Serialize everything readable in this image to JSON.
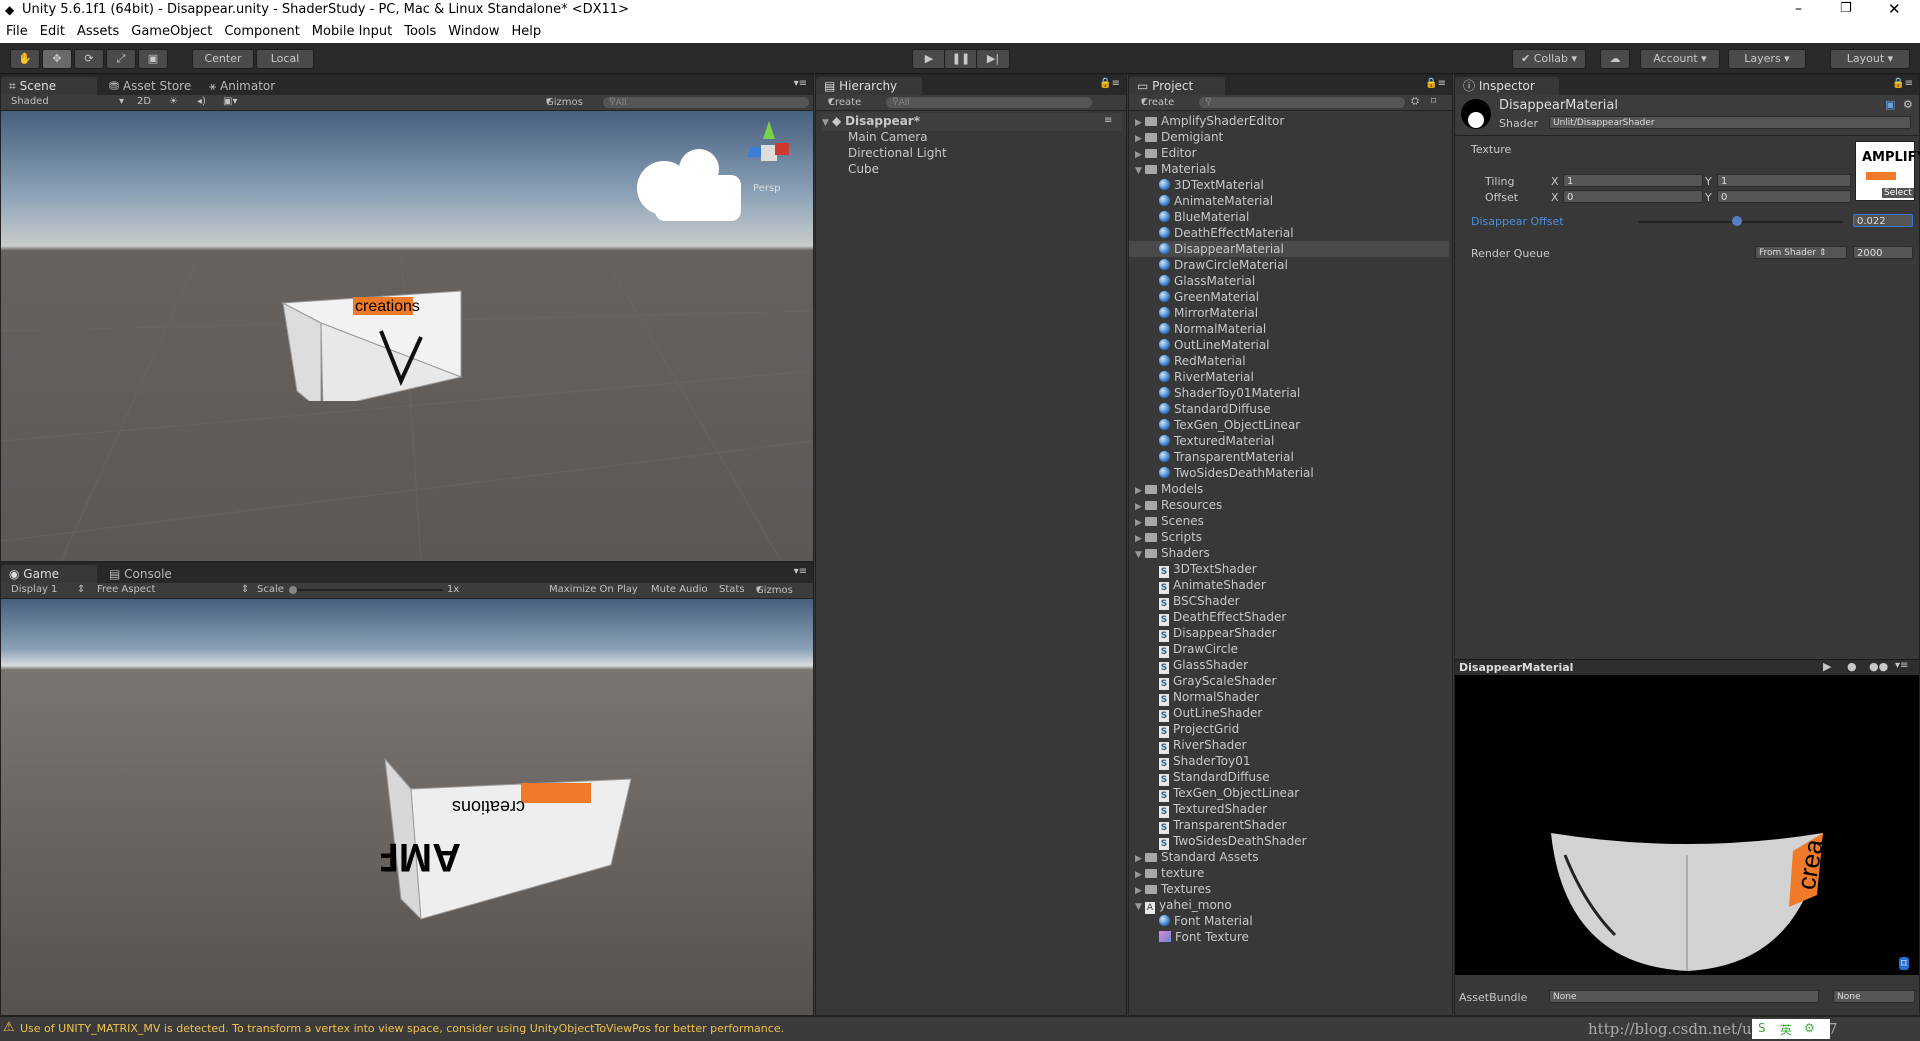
{
  "window": {
    "title": "Unity 5.6.1f1 (64bit) - Disappear.unity - ShaderStudy - PC, Mac & Linux Standalone* <DX11>"
  },
  "menu": [
    "File",
    "Edit",
    "Assets",
    "GameObject",
    "Component",
    "Mobile Input",
    "Tools",
    "Window",
    "Help"
  ],
  "toolbar": {
    "center": "Center",
    "local": "Local",
    "collab": "Collab",
    "account": "Account",
    "layers": "Layers",
    "layout": "Layout"
  },
  "scene_panel": {
    "tabs": [
      "Scene",
      "Asset Store",
      "Animator"
    ],
    "shaded": "Shaded",
    "mode_2d": "2D",
    "gizmos": "Gizmos",
    "search": "All",
    "persp": "Persp",
    "cube_text": "creations"
  },
  "game_panel": {
    "tabs": [
      "Game",
      "Console"
    ],
    "display": "Display 1",
    "aspect": "Free Aspect",
    "scale_label": "Scale",
    "scale_value": "1x",
    "maximize": "Maximize On Play",
    "mute": "Mute Audio",
    "stats": "Stats",
    "gizmos": "Gizmos",
    "cube_text_top": "creations",
    "cube_text_main": "AMPLIFY"
  },
  "hierarchy": {
    "tab": "Hierarchy",
    "create": "Create",
    "search": "All",
    "scene": "Disappear*",
    "items": [
      "Main Camera",
      "Directional Light",
      "Cube"
    ]
  },
  "project": {
    "tab": "Project",
    "create": "Create",
    "top_folders": [
      "AmplifyShaderEditor",
      "Demigiant",
      "Editor",
      "Materials"
    ],
    "materials": [
      "3DTextMaterial",
      "AnimateMaterial",
      "BlueMaterial",
      "DeathEffectMaterial",
      "DisappearMaterial",
      "DrawCircleMaterial",
      "GlassMaterial",
      "GreenMaterial",
      "MirrorMaterial",
      "NormalMaterial",
      "OutLineMaterial",
      "RedMaterial",
      "RiverMaterial",
      "ShaderToy01Material",
      "StandardDiffuse",
      "TexGen_ObjectLinear",
      "TexturedMaterial",
      "TransparentMaterial",
      "TwoSidesDeathMaterial"
    ],
    "selected": "DisappearMaterial",
    "mid_folders": [
      "Models",
      "Resources",
      "Scenes",
      "Scripts",
      "Shaders"
    ],
    "shaders": [
      "3DTextShader",
      "AnimateShader",
      "BSCShader",
      "DeathEffectShader",
      "DisappearShader",
      "DrawCircle",
      "GlassShader",
      "GrayScaleShader",
      "NormalShader",
      "OutLineShader",
      "ProjectGrid",
      "RiverShader",
      "ShaderToy01",
      "StandardDiffuse",
      "TexGen_ObjectLinear",
      "TexturedShader",
      "TransparentShader",
      "TwoSidesDeathShader"
    ],
    "bottom_folders": [
      "Standard Assets",
      "texture",
      "Textures"
    ],
    "font_asset": "yahei_mono",
    "font_children": [
      "Font Material",
      "Font Texture"
    ]
  },
  "inspector": {
    "tab": "Inspector",
    "material_name": "DisappearMaterial",
    "shader_label": "Shader",
    "shader_value": "Unlit/DisappearShader",
    "texture_label": "Texture",
    "texture_thumb": "AMPLIFY",
    "select": "Select",
    "tiling_label": "Tiling",
    "offset_label": "Offset",
    "x_label": "X",
    "y_label": "Y",
    "tiling_x": "1",
    "tiling_y": "1",
    "offset_x": "0",
    "offset_y": "0",
    "disappear_label": "Disappear Offset",
    "disappear_value": "0.022",
    "disappear_fraction": 0.022,
    "render_queue_label": "Render Queue",
    "render_queue_mode": "From Shader",
    "render_queue_value": "2000",
    "preview_title": "DisappearMaterial",
    "preview_text": "crea",
    "assetbundle_label": "AssetBundle",
    "assetbundle_value": "None",
    "assetbundle_variant": "None"
  },
  "status": {
    "message": "Use of UNITY_MATRIX_MV is detected. To transform a vertex into view space, consider using UnityObjectToViewPos for better performance."
  },
  "watermark": "http://blog.csdn.net/u013469717",
  "ime": "英"
}
